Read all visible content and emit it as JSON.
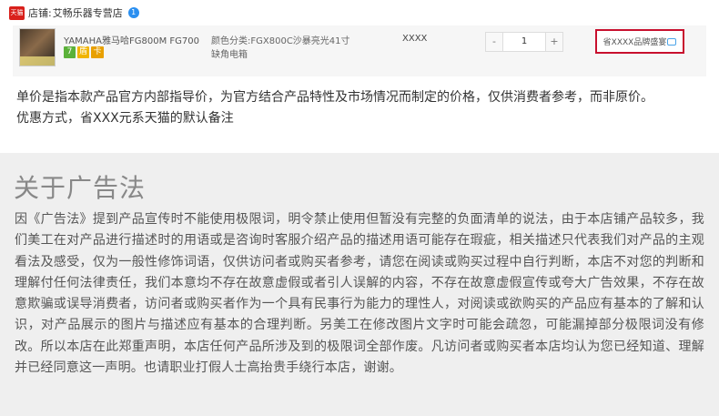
{
  "shop": {
    "icon_text": "天猫",
    "label": "店铺:",
    "name": "艾畅乐器专营店",
    "badge": "1"
  },
  "order": {
    "title": "YAMAHA雅马哈FG800M FG700...",
    "tags": [
      "7",
      "盾",
      "卡"
    ],
    "sku_label": "颜色分类:",
    "sku_value": "FGX800C沙暴亮光41寸",
    "sku_line2": "缺角电箱",
    "price": "XXXX",
    "qty_minus": "-",
    "qty_value": "1",
    "qty_plus": "+",
    "remark": "省XXXX品牌盛宴"
  },
  "notice": {
    "line1": "单价是指本款产品官方内部指导价，为官方结合产品特性及市场情况而制定的价格，仅供消费者参考，而非原价。",
    "line2": "优惠方式，省XXX元系天猫的默认备注"
  },
  "law": {
    "title": "关于广告法",
    "body": "因《广告法》提到产品宣传时不能使用极限词，明令禁止使用但暂没有完整的负面清单的说法，由于本店铺产品较多，我们美工在对产品进行描述时的用语或是咨询时客服介绍产品的描述用语可能存在瑕疵，相关描述只代表我们对产品的主观看法及感受，仅为一般性修饰词语，仅供访问者或购买者参考，请您在阅读或购买过程中自行判断，本店不对您的判断和理解付任何法律责任，我们本意均不存在故意虚假或者引人误解的内容，不存在故意虚假宣传或夸大广告效果，不存在故意欺骗或误导消费者，访问者或购买者作为一个具有民事行为能力的理性人，对阅读或欲购买的产品应有基本的了解和认识，对产品展示的图片与描述应有基本的合理判断。另美工在修改图片文字时可能会疏忽，可能漏掉部分极限词没有修改。所以本店在此郑重声明，本店任何产品所涉及到的极限词全部作废。凡访问者或购买者本店均认为您已经知道、理解并已经同意这一声明。也请职业打假人士高抬贵手绕行本店，谢谢。"
  }
}
